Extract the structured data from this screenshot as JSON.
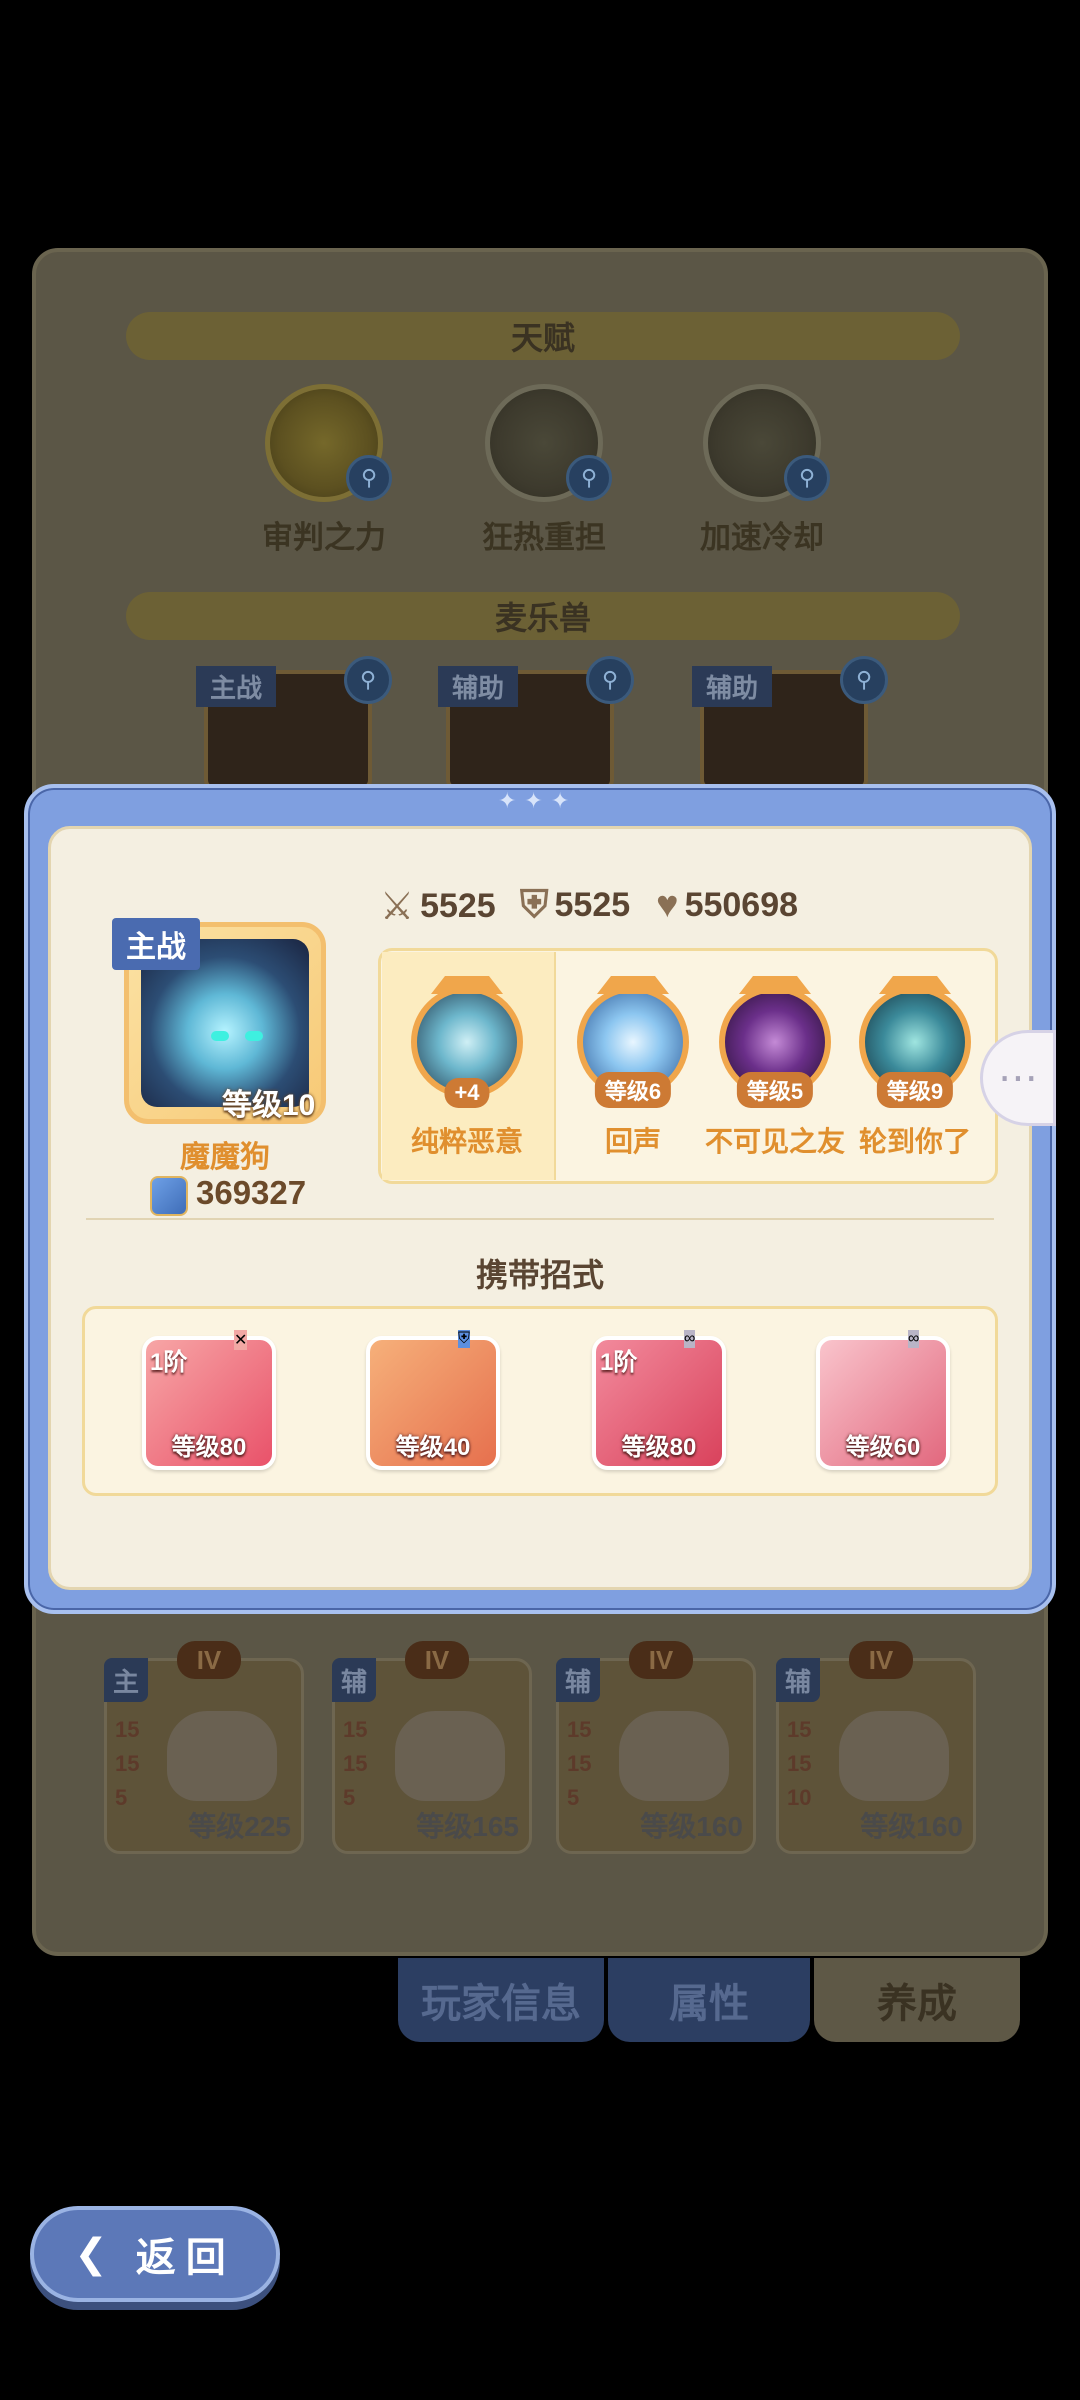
{
  "background_panel": {
    "talent_header": "天赋",
    "talents": [
      {
        "label": "审判之力",
        "icon": "sun-emblem-icon"
      },
      {
        "label": "狂热重担",
        "icon": "eye-triangle-icon"
      },
      {
        "label": "加速冷却",
        "icon": "wrapped-fist-icon"
      }
    ],
    "pet_header": "麦乐兽",
    "pets": [
      {
        "tag": "主战"
      },
      {
        "tag": "辅助"
      },
      {
        "tag": "辅助"
      }
    ],
    "team": [
      {
        "role": "主",
        "rank": "IV",
        "stats": [
          "15",
          "15",
          "5"
        ],
        "level": "等级225"
      },
      {
        "role": "辅",
        "rank": "IV",
        "stats": [
          "15",
          "15",
          "5"
        ],
        "level": "等级165"
      },
      {
        "role": "辅",
        "rank": "IV",
        "stats": [
          "15",
          "15",
          "5"
        ],
        "level": "等级160"
      },
      {
        "role": "辅",
        "rank": "IV",
        "stats": [
          "15",
          "15",
          "10"
        ],
        "level": "等级160"
      }
    ],
    "tabs": [
      {
        "label": "玩家信息",
        "active": false
      },
      {
        "label": "属性",
        "active": false
      },
      {
        "label": "养成",
        "active": true
      }
    ]
  },
  "return_button": {
    "label": "返回"
  },
  "modal": {
    "hero": {
      "tag": "主战",
      "level": "等级10",
      "name": "魔魔狗",
      "power": "369327"
    },
    "stats": {
      "attack": "5525",
      "defense": "5525",
      "hp": "550698"
    },
    "skills": [
      {
        "name": "纯粹恶意",
        "level": "+4"
      },
      {
        "name": "回声",
        "level": "等级6"
      },
      {
        "name": "不可见之友",
        "level": "等级5"
      },
      {
        "name": "轮到你了",
        "level": "等级9"
      }
    ],
    "moves_title": "携带招式",
    "moves": [
      {
        "rank": "1阶",
        "level": "等级80",
        "badge": "attack-badge-icon"
      },
      {
        "rank": "",
        "level": "等级40",
        "badge": "shield-badge-icon"
      },
      {
        "rank": "1阶",
        "level": "等级80",
        "badge": "link-badge-icon"
      },
      {
        "rank": "",
        "level": "等级60",
        "badge": "link-badge-icon"
      }
    ]
  },
  "colors": {
    "accent_blue": "#7f9fe0",
    "gold": "#f0a64b",
    "text_orange": "#e08f2e"
  }
}
